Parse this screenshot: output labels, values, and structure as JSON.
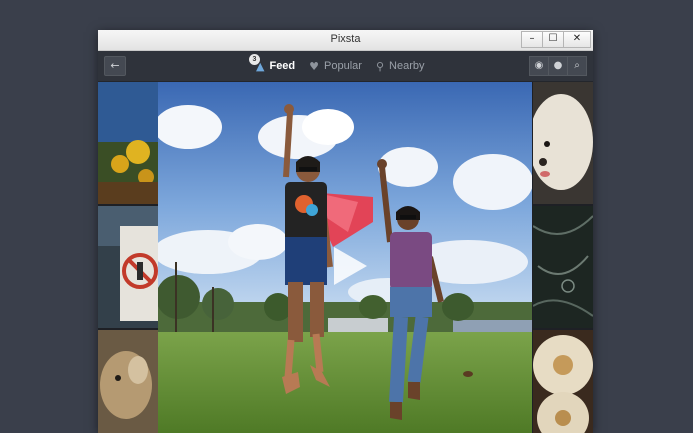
{
  "window": {
    "title": "Pixsta",
    "controls": [
      "–",
      "☐",
      "✕"
    ]
  },
  "toolbar": {
    "back_icon": "←",
    "nav": [
      {
        "label": "Feed",
        "icon": "feed-icon",
        "glyph": "▲",
        "badge": "3",
        "active": true
      },
      {
        "label": "Popular",
        "icon": "heart-icon",
        "glyph": "♥",
        "active": false
      },
      {
        "label": "Nearby",
        "icon": "pin-icon",
        "glyph": "⚲",
        "active": false
      }
    ],
    "tools": [
      {
        "name": "camera-icon",
        "glyph": "◉"
      },
      {
        "name": "user-icon",
        "glyph": "●"
      },
      {
        "name": "search-icon",
        "glyph": "⌕"
      }
    ]
  },
  "colors": {
    "desktop": "#3a3f4b",
    "toolbar": "#2f333b",
    "active_tab": "#ffffff",
    "inactive_tab": "#9aa0a8"
  },
  "main_photo": {
    "subject": "two women jumping in a park",
    "overlay": "play-icon"
  }
}
